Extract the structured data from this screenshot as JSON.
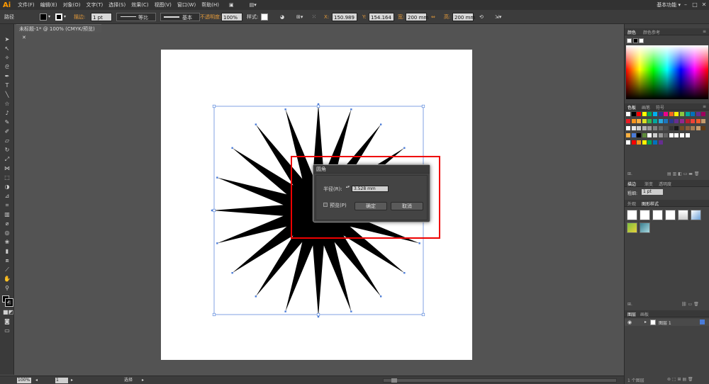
{
  "app": {
    "logo": "Ai",
    "workspace": "基本功能 ▾"
  },
  "menu": [
    "文件(F)",
    "编辑(E)",
    "对象(O)",
    "文字(T)",
    "选择(S)",
    "效果(C)",
    "视图(V)",
    "窗口(W)",
    "帮助(H)"
  ],
  "controlbar": {
    "selection_label": "路径",
    "stroke_label": "描边:",
    "stroke_value": "1 pt",
    "stroke_profile": "等比",
    "brush": "基本",
    "opacity_label": "不透明度:",
    "opacity_value": "100%",
    "style_label": "样式:",
    "x_label": "X:",
    "x_value": "150.989",
    "y_label": "Y:",
    "y_value": "154.164",
    "w_label": "宽:",
    "w_value": "200 mm",
    "h_label": "高:",
    "h_value": "200 mm"
  },
  "document_tab": "未标题-1* @ 100% (CMYK/预览)",
  "dialog": {
    "title": "圆角",
    "radius_label": "半径(R):",
    "radius_value": "3.528 mm",
    "preview_label": "预览(P)",
    "ok_label": "确定",
    "cancel_label": "取消"
  },
  "statusbar": {
    "zoom": "100%",
    "page": "1",
    "tool": "选择"
  },
  "panels": {
    "color_tabs": [
      "颜色",
      "颜色参考"
    ],
    "swatch_tabs": [
      "色板",
      "画笔",
      "符号"
    ],
    "stroke_tabs": [
      "描边",
      "渐变",
      "透明度"
    ],
    "stroke_weight_label": "粗细:",
    "stroke_weight_value": "1 pt",
    "style_tabs": [
      "外观",
      "图形样式"
    ],
    "layer_tabs": [
      "图层",
      "画板"
    ],
    "layer_name": "图层 1",
    "layer_count": "1 个图层"
  },
  "colors": {
    "accent": "#ff9a00",
    "highlight_box": "#ee0000",
    "selection": "#4a7bd8"
  }
}
